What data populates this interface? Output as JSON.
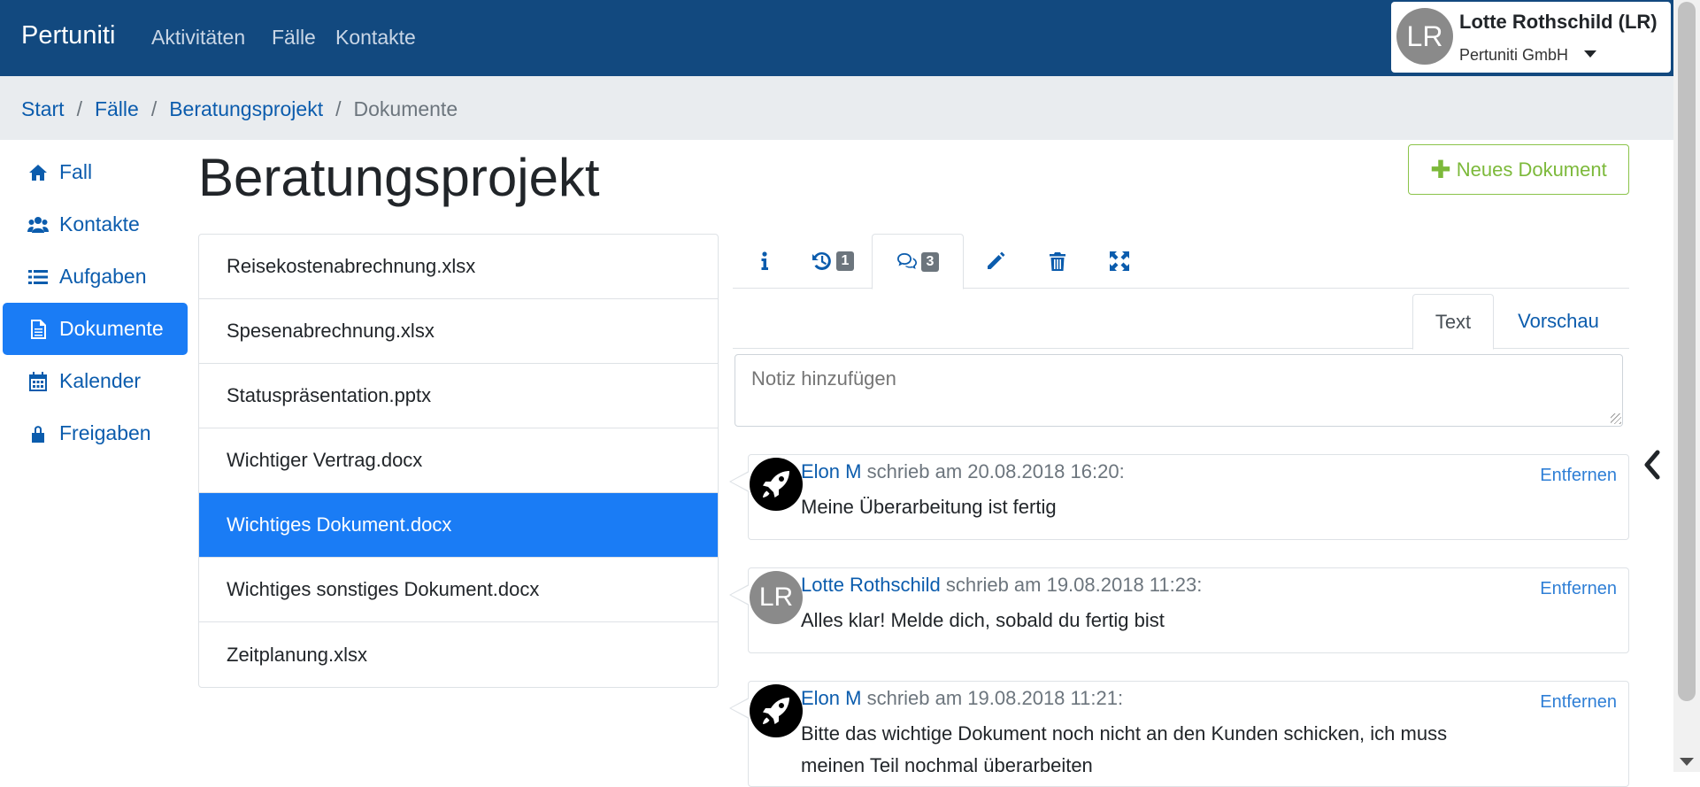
{
  "navbar": {
    "brand": "Pertuniti",
    "links": [
      "Aktivitäten",
      "Fälle",
      "Kontakte"
    ],
    "user": {
      "initials": "LR",
      "name": "Lotte Rothschild (LR)",
      "org": "Pertuniti GmbH"
    }
  },
  "breadcrumb": {
    "items": [
      "Start",
      "Fälle",
      "Beratungsprojekt"
    ],
    "current": "Dokumente",
    "separator": "/"
  },
  "sidebar": {
    "items": [
      {
        "label": "Fall",
        "icon": "home-icon"
      },
      {
        "label": "Kontakte",
        "icon": "users-icon"
      },
      {
        "label": "Aufgaben",
        "icon": "list-icon"
      },
      {
        "label": "Dokumente",
        "icon": "document-icon",
        "active": true
      },
      {
        "label": "Kalender",
        "icon": "calendar-icon"
      },
      {
        "label": "Freigaben",
        "icon": "lock-icon"
      }
    ]
  },
  "main": {
    "title": "Beratungsprojekt",
    "new_button": "Neues Dokument"
  },
  "files": [
    "Reisekostenabrechnung.xlsx",
    "Spesenabrechnung.xlsx",
    "Statuspräsentation.pptx",
    "Wichtiger Vertrag.docx",
    "Wichtiges Dokument.docx",
    "Wichtiges sonstiges Dokument.docx",
    "Zeitplanung.xlsx"
  ],
  "selected_file": "Wichtiges Dokument.docx",
  "detail_tabs": {
    "history_count": "1",
    "comments_count": "3"
  },
  "sub_tabs": {
    "text": "Text",
    "preview": "Vorschau"
  },
  "note": {
    "placeholder": "Notiz hinzufügen"
  },
  "comments": [
    {
      "author": "Elon M",
      "meta": " schrieb am 20.08.2018 16:20:",
      "body": "Meine Überarbeitung ist fertig",
      "remove": "Entfernen",
      "avatar": "rocket-icon"
    },
    {
      "author": "Lotte Rothschild",
      "meta": " schrieb am 19.08.2018 11:23:",
      "body": "Alles klar! Melde dich, sobald du fertig bist",
      "remove": "Entfernen",
      "avatar": "LR"
    },
    {
      "author": "Elon M",
      "meta": " schrieb am 19.08.2018 11:21:",
      "body": "Bitte das wichtige Dokument noch nicht an den Kunden schicken, ich muss meinen Teil nochmal überarbeiten",
      "remove": "Entfernen",
      "avatar": "rocket-icon"
    }
  ],
  "colors": {
    "navbar": "#12497f",
    "accent": "#1a7cf5",
    "link": "#0b5cad",
    "success": "#7cb93a"
  }
}
